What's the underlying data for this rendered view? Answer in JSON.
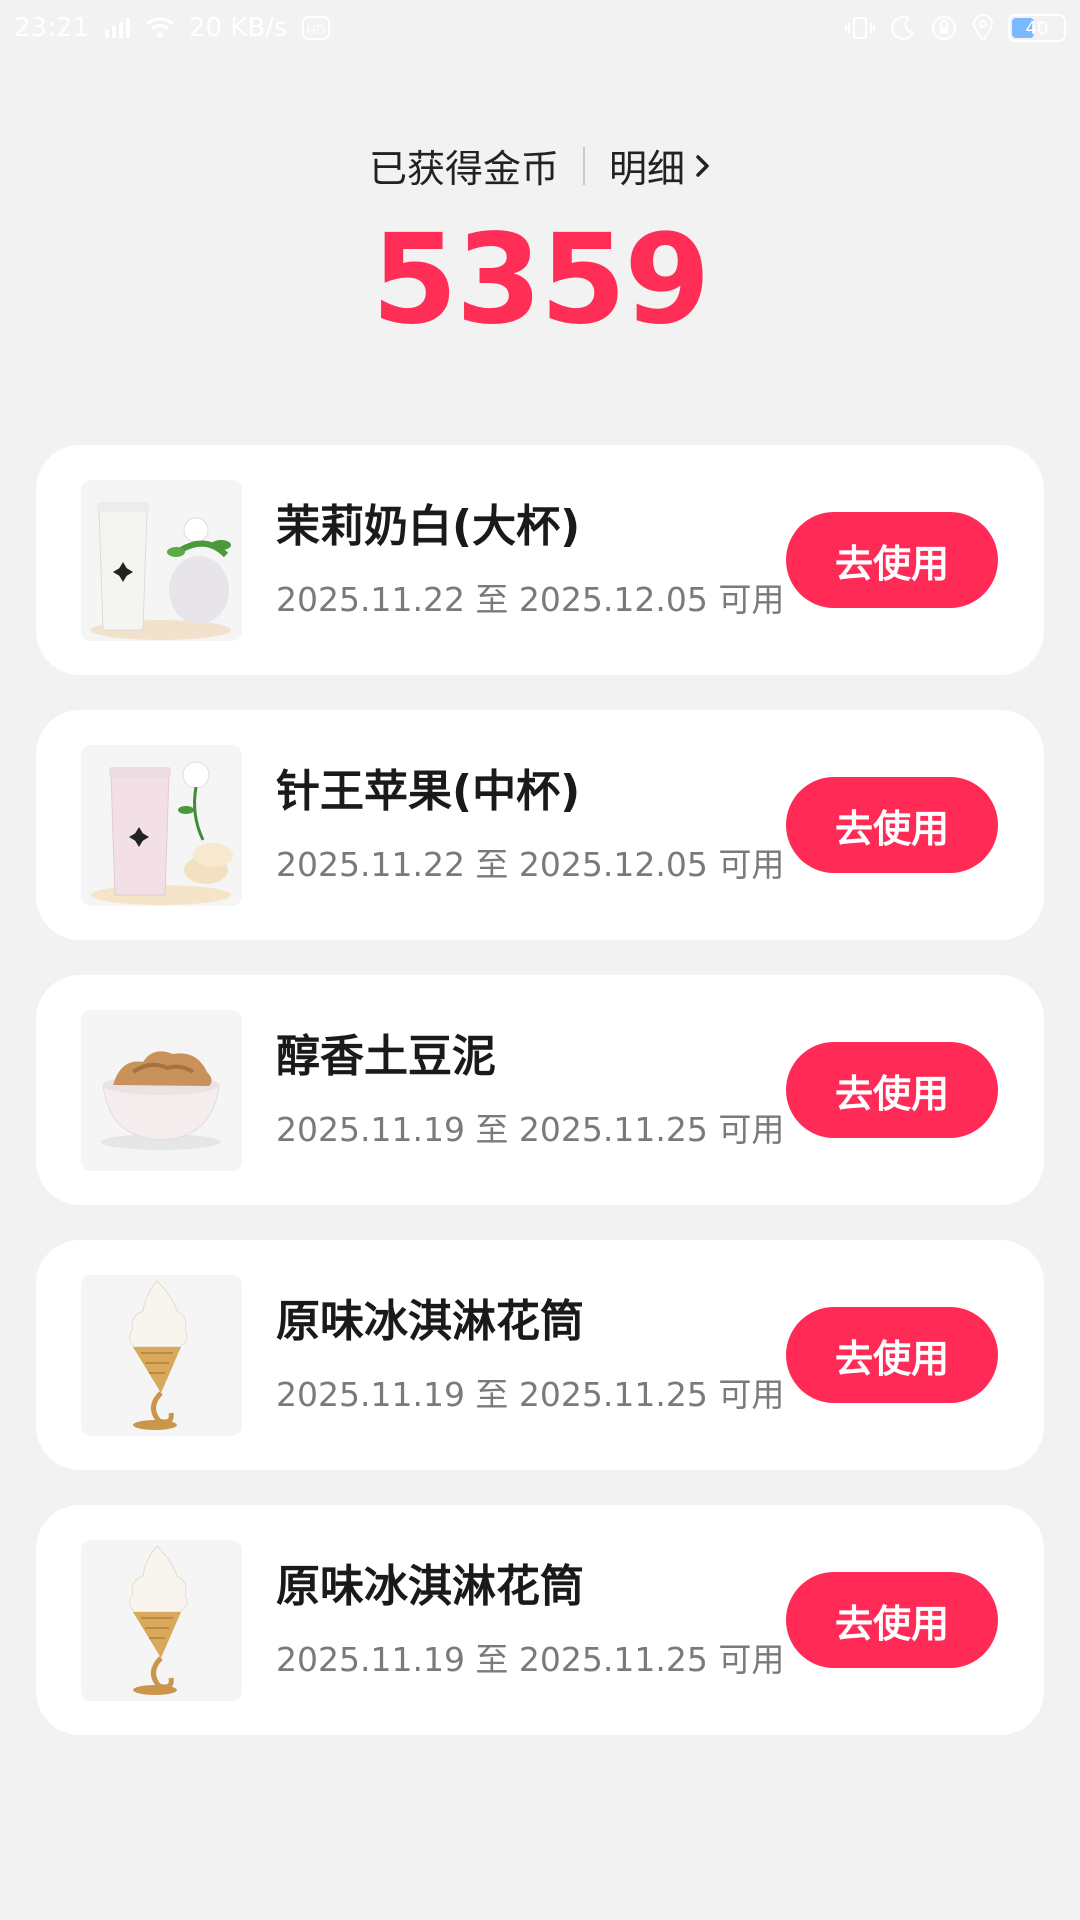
{
  "status_bar": {
    "time": "23:21",
    "network_speed": "20 KB/s",
    "battery": "40",
    "icons": [
      "signal-icon",
      "wifi-icon",
      "hd-icon",
      "vibrate-icon",
      "moon-icon",
      "lock-rotation-icon",
      "location-icon",
      "battery-icon"
    ]
  },
  "header": {
    "earned_label": "已获得金币",
    "detail_label": "明细",
    "coin_amount": "5359"
  },
  "colors": {
    "accent": "#ff2e56",
    "background": "#f2f2f2"
  },
  "coupons": [
    {
      "title": "茉莉奶白(大杯)",
      "date": "2025.11.22 至 2025.12.05 可用",
      "button": "去使用",
      "image": "jasmine-milk-tea-image"
    },
    {
      "title": "针王苹果(中杯)",
      "date": "2025.11.22 至 2025.12.05 可用",
      "button": "去使用",
      "image": "apple-tea-image"
    },
    {
      "title": "醇香土豆泥",
      "date": "2025.11.19 至 2025.11.25 可用",
      "button": "去使用",
      "image": "mashed-potato-image"
    },
    {
      "title": "原味冰淇淋花筒",
      "date": "2025.11.19 至 2025.11.25 可用",
      "button": "去使用",
      "image": "ice-cream-cone-image"
    },
    {
      "title": "原味冰淇淋花筒",
      "date": "2025.11.19 至 2025.11.25 可用",
      "button": "去使用",
      "image": "ice-cream-cone-image"
    }
  ]
}
